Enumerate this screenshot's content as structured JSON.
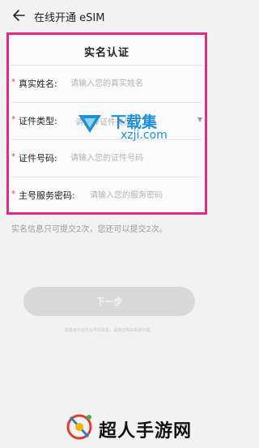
{
  "header": {
    "title": "在线开通 eSIM",
    "back_icon": "arrow-left-icon"
  },
  "form": {
    "heading": "实名认证",
    "required_mark": "*",
    "fields": [
      {
        "label": "真实姓名:",
        "placeholder": "请输入您的真实姓名",
        "value": ""
      },
      {
        "label": "证件类型:",
        "placeholder": "请选择证件类型",
        "value": "请选择证件类型"
      },
      {
        "label": "证件号码:",
        "placeholder": "请输入您的证件号码",
        "value": ""
      },
      {
        "label": "主号服务密码:",
        "placeholder": "请输入您的服务密码",
        "value": ""
      }
    ],
    "highlight_color": "#e02b84"
  },
  "notice": "实名信息只可提交2次，您还可以提交2次。",
  "next_button": {
    "label": "下一步",
    "state": "disabled"
  },
  "fine_print": "如需身份证件及号码变更，请通过相关渠道办理。",
  "watermark": {
    "title": "下载集",
    "subtitle": "xzji.com",
    "color": "#1f8fd6"
  },
  "footer_brand": {
    "text": "超人手游网"
  }
}
